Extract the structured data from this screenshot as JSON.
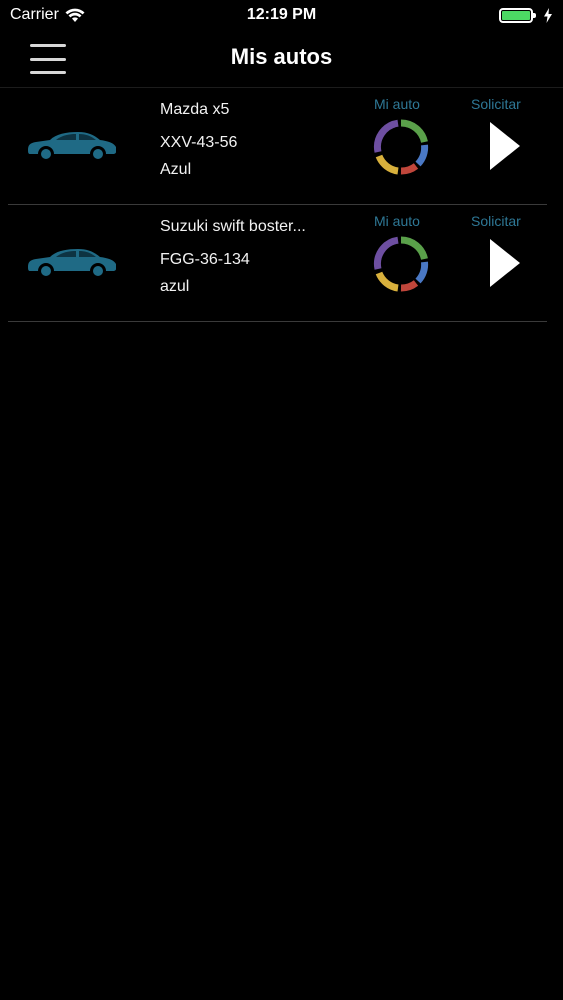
{
  "status_bar": {
    "carrier": "Carrier",
    "time": "12:19 PM"
  },
  "nav": {
    "title": "Mis autos"
  },
  "colors": {
    "background": "#000000",
    "accent": "#2e7896",
    "car_icon": "#1f6a85",
    "ring": [
      "#4a78c4",
      "#c0463b",
      "#d8b03c",
      "#6e4fa1",
      "#5aa04a"
    ],
    "battery": "#4cd964"
  },
  "cars": [
    {
      "model": "Mazda x5",
      "plate": "XXV-43-56",
      "color": "Azul",
      "mi_auto_label": "Mi auto",
      "solicitar_label": "Solicitar"
    },
    {
      "model": "Suzuki swift boster...",
      "plate": "FGG-36-134",
      "color": "azul",
      "mi_auto_label": "Mi auto",
      "solicitar_label": "Solicitar"
    }
  ]
}
